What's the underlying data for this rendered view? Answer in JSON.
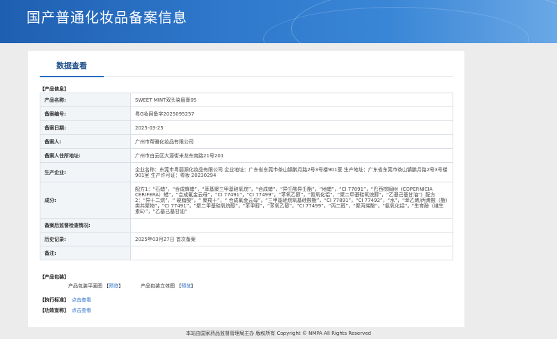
{
  "header": {
    "title": "国产普通化妆品备案信息"
  },
  "tabs": {
    "active_label": "数据查看"
  },
  "sections": {
    "product_info": "【产品信息】",
    "packaging": "【产品包装】",
    "standard": "【执行标准】",
    "efficacy": "【功效宣称】"
  },
  "info_rows": [
    {
      "label": "产品名称:",
      "value": "SWEET MINT双头染眉膏05"
    },
    {
      "label": "备案编号:",
      "value": "粤G妆网备字2025095257"
    },
    {
      "label": "备案日期:",
      "value": "2025-03-25"
    },
    {
      "label": "备案人:",
      "value": "广州市帮雅化妆品有限公司"
    },
    {
      "label": "备案人住所地址:",
      "value": "广州市白云区大源街米龙东南路21号201"
    },
    {
      "label": "生产企业:",
      "value": "企业名称：东莞市粤丽源化妆品有限公司 企业地址：广东省东莞市茶山镇鹏月路2号3号楼901室 生产地址：广东省东莞市茶山镇鹏月路2号3号楼901室 生产许可证：粤妆 20230294"
    },
    {
      "label": "成分:",
      "value": "配方1：“石蜡”，“合成蜂蜡”，“苯基聚三甲基硅氧烷”，“合成蜡”，“异壬酸异壬酯”，“地蜡”，“CI 77891”，“巴西棕榈树（COPERNICIA CERIFERA）蜡”，“合成氟金云母”，“CI 77491”，“CI 77499”，“苯氧乙醇”，“氮氧化铝”，“聚二甲基硅氧烷醇”，“乙基己基甘油”）配方2：“异十二烷”，“ 硬脂酸”，“ 聚羧十”，“ 合成氟金云母”，“三甲基硅烷氧基硅酸酯”，“CI 77891”，“CI 77492”，“水”，“苯乙烯/丙烯酸（酯）类共聚物”，“CI 77491”，“聚二甲基硅氧烷醇”，“苯甲醇”，“苯氧乙醇”，“CI 77499”，“丙二醇”，“聚丙烯酸”，“氨氧化铝”，“生育酚（维生素E）”，“乙基己基甘油”"
    },
    {
      "label": "备案后监督检查情况:",
      "value": ""
    },
    {
      "label": "历史记录:",
      "value": "2025年03月27日 首次备案"
    },
    {
      "label": "备注:",
      "value": ""
    }
  ],
  "packaging": {
    "flat_label": "产品包装平面图",
    "flat_link": "预览",
    "solid_label": "产品包装立体图",
    "solid_link": "预览",
    "bracket_open": "【",
    "bracket_close": "】"
  },
  "links": {
    "view": "点击查看"
  },
  "footer": {
    "text": "本站由国家药品监督管理局主办 版权所有 Copyright © NMPA All Rights Reserved"
  }
}
